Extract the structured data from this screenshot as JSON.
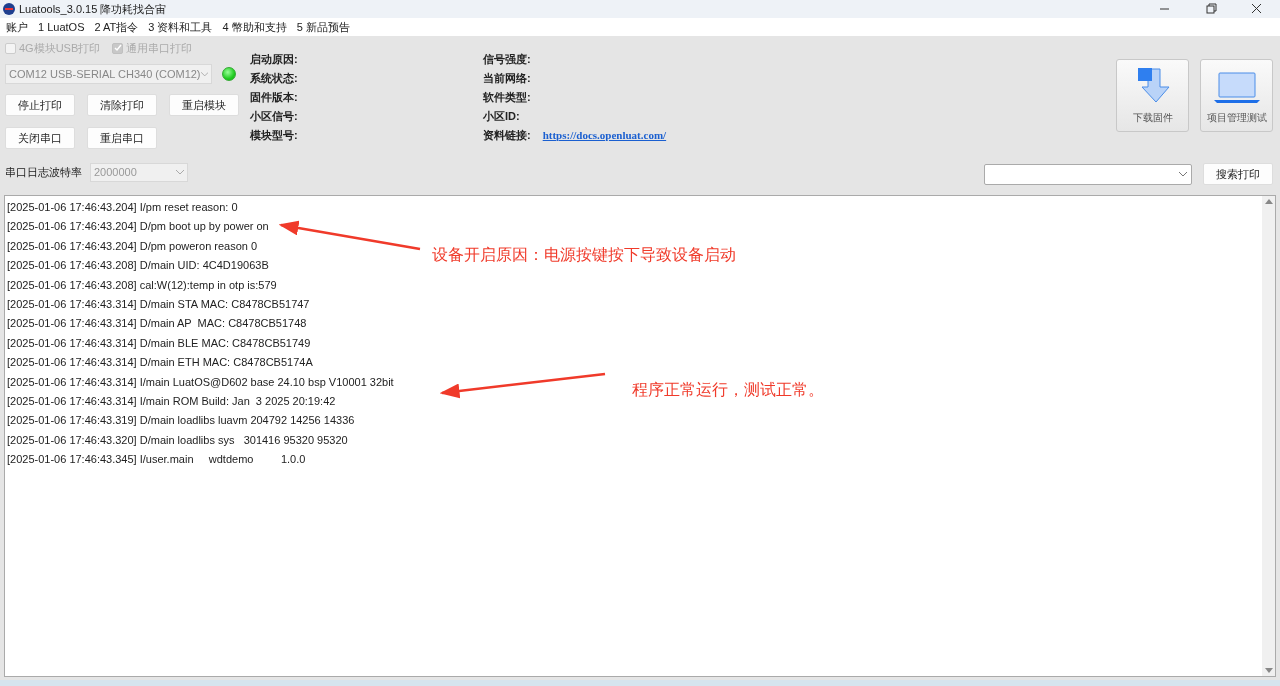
{
  "window": {
    "title": "Luatools_3.0.15 降功耗找合宙"
  },
  "menu": [
    "账户",
    "1 LuatOS",
    "2 AT指令",
    "3 资料和工具",
    "4 幣助和支持",
    "5 新品预告"
  ],
  "options": [
    {
      "label": "4G模块USB打印",
      "checked": false,
      "disabled": true
    },
    {
      "label": "通用串口打印",
      "checked": true,
      "disabled": true
    }
  ],
  "port": {
    "value": "COM12 USB-SERIAL CH340 (COM12)",
    "connected": true
  },
  "buttons": [
    [
      "停止打印",
      "清除打印",
      "重启模块"
    ],
    [
      "关闭串口",
      "重启串口"
    ]
  ],
  "baud": {
    "label": "串口日志波特率",
    "value": "2000000"
  },
  "info_left": [
    "启动原因:",
    "系统状态:",
    "固件版本:",
    "小区信号:",
    "模块型号:"
  ],
  "info_right": [
    {
      "label": "信号强度:"
    },
    {
      "label": "当前网络:"
    },
    {
      "label": "软件类型:"
    },
    {
      "label": "小区ID:"
    },
    {
      "label": "资料链接:",
      "link": "https://docs.openluat.com/"
    }
  ],
  "tools": [
    {
      "kind": "download",
      "label": "下载固件"
    },
    {
      "kind": "project",
      "label": "项目管理测试"
    }
  ],
  "search_button": "搜索打印",
  "log": [
    "[2025-01-06 17:46:43.204] I/pm reset reason: 0",
    "[2025-01-06 17:46:43.204] D/pm boot up by power on",
    "[2025-01-06 17:46:43.204] D/pm poweron reason 0",
    "[2025-01-06 17:46:43.208] D/main UID: 4C4D19063B",
    "[2025-01-06 17:46:43.208] cal:W(12):temp in otp is:579",
    "[2025-01-06 17:46:43.314] D/main STA MAC: C8478CB51747",
    "[2025-01-06 17:46:43.314] D/main AP  MAC: C8478CB51748",
    "[2025-01-06 17:46:43.314] D/main BLE MAC: C8478CB51749",
    "[2025-01-06 17:46:43.314] D/main ETH MAC: C8478CB5174A",
    "[2025-01-06 17:46:43.314] I/main LuatOS@D602 base 24.10 bsp V10001 32bit",
    "[2025-01-06 17:46:43.314] I/main ROM Build: Jan  3 2025 20:19:42",
    "[2025-01-06 17:46:43.319] D/main loadlibs luavm 204792 14256 14336",
    "[2025-01-06 17:46:43.320] D/main loadlibs sys   301416 95320 95320",
    "[2025-01-06 17:46:43.345] I/user.main     wdtdemo         1.0.0"
  ],
  "annotations": [
    "设备开启原因：电源按键按下导致设备启动",
    "程序正常运行，测试正常。"
  ]
}
